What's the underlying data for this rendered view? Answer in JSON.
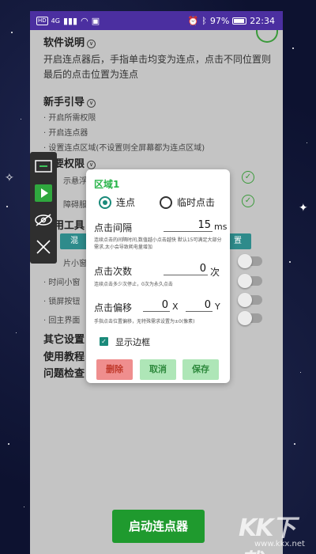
{
  "status_bar": {
    "hd": "HD",
    "signal": "4G",
    "battery": "97%",
    "time": "22:34"
  },
  "sections": {
    "software_title": "软件说明",
    "software_desc": "开启连点器后，手指单击均变为连点，点击不同位置则最后的点击位置为连点",
    "guide_title": "新手引导",
    "guide_items": [
      "· 开启所需权限",
      "· 开启连点器",
      "· 设置连点区域(不设置则全屏幕都为连点区域)"
    ],
    "perm_title": "必要权限",
    "perm_items": [
      "示悬浮窗",
      "障碍服务"
    ],
    "tools_title": "实用工具",
    "tools_btn_left": "混",
    "tools_btn_right": "置",
    "tool_items": [
      "片小窗",
      "· 时间小窗",
      "· 锁屏按钮",
      "· 回主界面"
    ],
    "other_title": "其它设置",
    "tutorial_title": "使用教程",
    "issue_title": "问题检查"
  },
  "start_button": "启动连点器",
  "dialog": {
    "title": "区域1",
    "radio_continuous": "连点",
    "radio_temp": "临时点击",
    "interval_label": "点击间隔",
    "interval_value": "15",
    "interval_unit": "ms",
    "interval_hint": "连续点击的间隔时间,数值越小点击越快 默认15可满足大部分需求,太小会导致耗电量增加",
    "count_label": "点击次数",
    "count_value": "0",
    "count_unit": "次",
    "count_hint": "连续点击多少次停止，0次为永久点击",
    "offset_label": "点击偏移",
    "offset_x": "0",
    "offset_x_unit": "X",
    "offset_y": "0",
    "offset_y_unit": "Y",
    "offset_hint": "手指点击位置偏移，无特殊需求设置为±0(像素)",
    "show_border_label": "显示边框",
    "show_border_checked": true,
    "delete_label": "删除",
    "cancel_label": "取消",
    "save_label": "保存"
  },
  "watermark": {
    "text": "KK下载",
    "url": "www.kkx.net"
  },
  "colors": {
    "accent_green": "#1f9a2e",
    "status_bar": "#4b2fa0",
    "dialog_title": "#29b44a",
    "radio_teal": "#1a8a7a",
    "delete_red": "#ef8e8e",
    "confirm_green": "#aee6b7"
  }
}
